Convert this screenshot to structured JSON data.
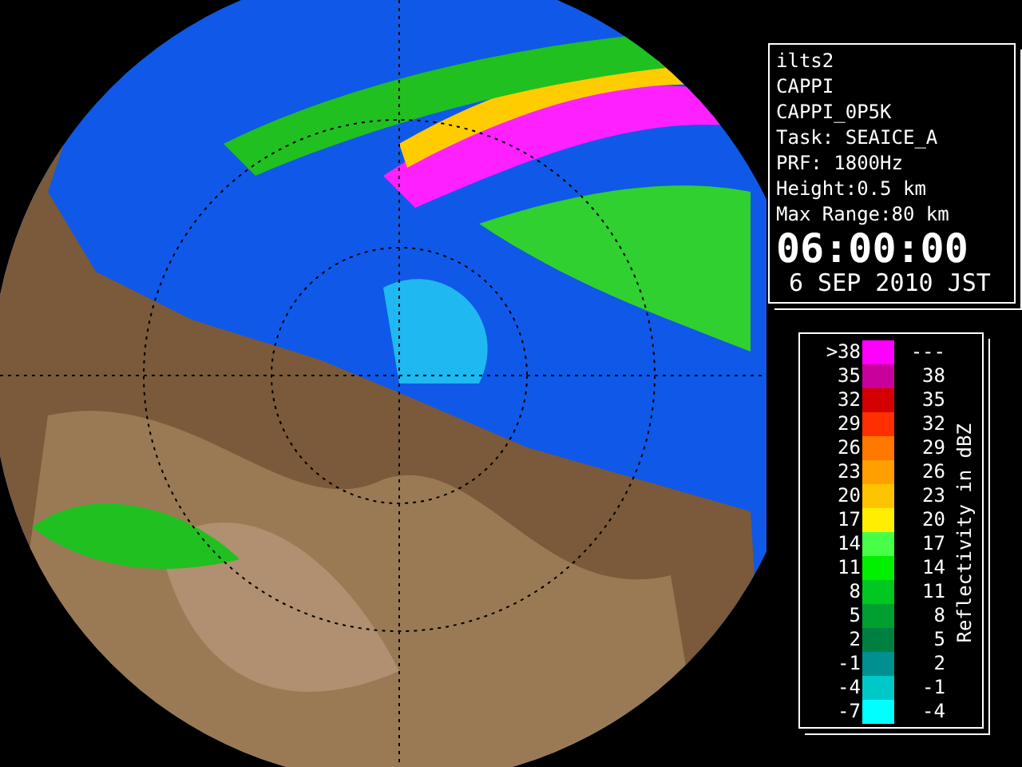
{
  "info": {
    "lines": [
      "ilts2",
      "CAPPI",
      "CAPPI_0P5K",
      "Task: SEAICE_A",
      "PRF: 1800Hz",
      "Height:0.5 km",
      "Max Range:80 km"
    ],
    "time": "06:00:00",
    "date": "6 SEP 2010 JST"
  },
  "legend": {
    "title": "Reflectivity in dBZ",
    "rows": [
      {
        "lower": ">38",
        "upper": "---",
        "color": "#ff00ff"
      },
      {
        "lower": "35",
        "upper": "38",
        "color": "#c8009c"
      },
      {
        "lower": "32",
        "upper": "35",
        "color": "#d40000"
      },
      {
        "lower": "29",
        "upper": "32",
        "color": "#ff3000"
      },
      {
        "lower": "26",
        "upper": "29",
        "color": "#ff7800"
      },
      {
        "lower": "23",
        "upper": "26",
        "color": "#ffa000"
      },
      {
        "lower": "20",
        "upper": "23",
        "color": "#ffc400"
      },
      {
        "lower": "17",
        "upper": "20",
        "color": "#ffee00"
      },
      {
        "lower": "14",
        "upper": "17",
        "color": "#48ff48"
      },
      {
        "lower": "11",
        "upper": "14",
        "color": "#00f000"
      },
      {
        "lower": "8",
        "upper": "11",
        "color": "#00c820"
      },
      {
        "lower": "5",
        "upper": "8",
        "color": "#00a030"
      },
      {
        "lower": "2",
        "upper": "5",
        "color": "#008040"
      },
      {
        "lower": "-1",
        "upper": "2",
        "color": "#009090"
      },
      {
        "lower": "-4",
        "upper": "-1",
        "color": "#00c8c8"
      },
      {
        "lower": "-7",
        "upper": "-4",
        "color": "#00ffff"
      }
    ]
  }
}
